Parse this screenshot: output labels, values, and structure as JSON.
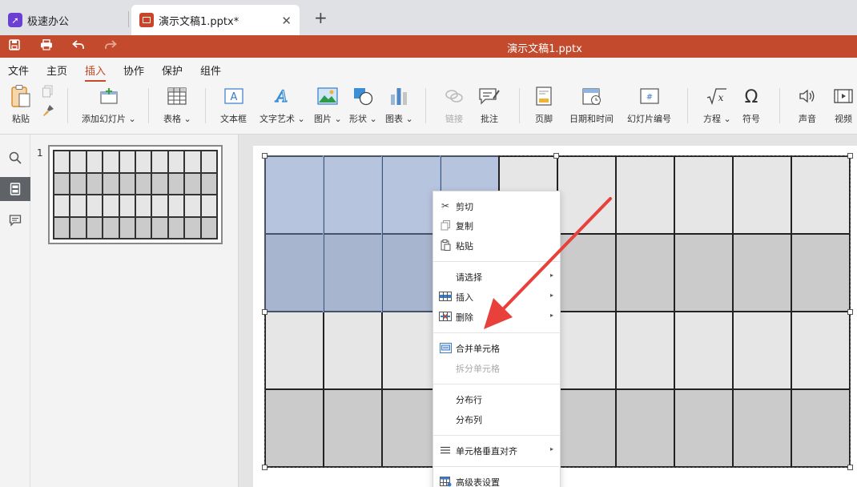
{
  "tabs": {
    "home_label": "极速办公",
    "doc_label": "演示文稿1.pptx*",
    "close_glyph": "✕",
    "add_glyph": "+"
  },
  "titlebar": {
    "title": "演示文稿1.pptx"
  },
  "menu": [
    "文件",
    "主页",
    "插入",
    "协作",
    "保护",
    "组件"
  ],
  "menu_active": "插入",
  "toolbar": {
    "paste": "粘贴",
    "add_slide": "添加幻灯片",
    "table": "表格",
    "textbox": "文本框",
    "textart": "文字艺术",
    "image": "图片",
    "shape": "形状",
    "chart": "图表",
    "link": "链接",
    "comment": "批注",
    "footer": "页脚",
    "datetime": "日期和时间",
    "slide_number": "幻灯片编号",
    "equation": "方程",
    "symbol": "符号",
    "audio": "声音",
    "video": "视频",
    "dropdown_glyph": "⌄"
  },
  "thumbnail": {
    "number": "1"
  },
  "context_menu": {
    "cut": "剪切",
    "copy": "复制",
    "paste": "粘贴",
    "select": "请选择",
    "insert": "插入",
    "delete": "删除",
    "merge_cells": "合并单元格",
    "split_cells": "拆分单元格",
    "distribute_rows": "分布行",
    "distribute_cols": "分布列",
    "vertical_align": "单元格垂直对齐",
    "advanced_table": "高级表设置",
    "submenu_glyph": "▸"
  },
  "colors": {
    "accent": "#c34a2c",
    "cell_light": "#e6e6e6",
    "cell_dark": "#cbcbcb",
    "selection": "#7896d2",
    "arrow": "#e8403a"
  }
}
